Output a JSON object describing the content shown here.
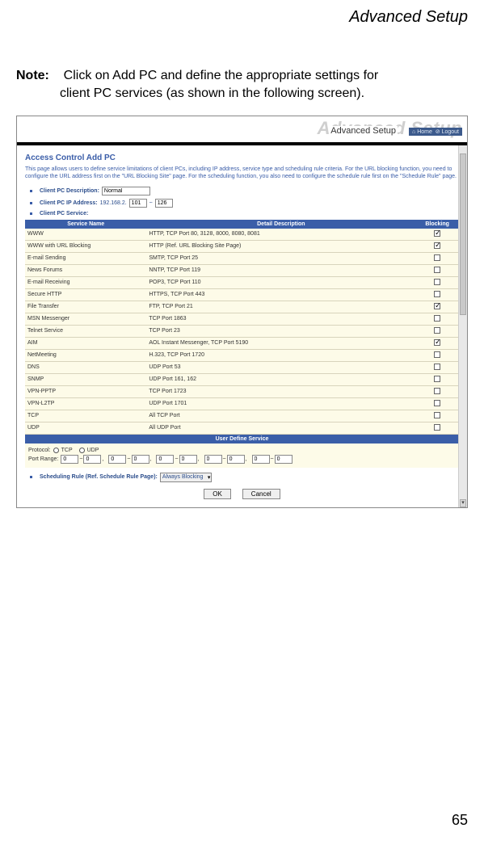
{
  "header": {
    "title": "Advanced Setup"
  },
  "note": {
    "label": "Note:",
    "line1": "Click on Add PC and define the appropriate settings for",
    "line2": "client PC services (as shown in the following screen)."
  },
  "screenshot": {
    "watermark": "Advanced Setup",
    "overlay": "Advanced Setup",
    "nav_home": "Home",
    "nav_logout": "Logout",
    "panel_title": "Access Control Add PC",
    "panel_desc": "This page allows users to define service limitations of client PCs, including IP address, service type and scheduling rule criteria. For the URL blocking function, you need to configure the URL address first on the \"URL Blocking Site\" page. For the scheduling function, you also need to configure the schedule rule first on the \"Schedule Rule\" page.",
    "client_desc_label": "Client PC Description:",
    "client_desc_value": "Normal",
    "client_ip_label": "Client PC IP Address:",
    "ip_prefix": "192.168.2.",
    "ip_from": "101",
    "ip_sep": "~",
    "ip_to": "126",
    "client_service_label": "Client PC Service:",
    "table_headers": {
      "name": "Service Name",
      "desc": "Detail Description",
      "blk": "Blocking"
    },
    "services": [
      {
        "name": "WWW",
        "desc": "HTTP, TCP Port 80, 3128, 8000, 8080, 8081",
        "checked": true
      },
      {
        "name": "WWW with URL Blocking",
        "desc": "HTTP (Ref. URL Blocking Site Page)",
        "checked": true
      },
      {
        "name": "E-mail Sending",
        "desc": "SMTP, TCP Port 25",
        "checked": false
      },
      {
        "name": "News Forums",
        "desc": "NNTP, TCP Port 119",
        "checked": false
      },
      {
        "name": "E-mail Receiving",
        "desc": "POP3, TCP Port 110",
        "checked": false
      },
      {
        "name": "Secure HTTP",
        "desc": "HTTPS, TCP Port 443",
        "checked": false
      },
      {
        "name": "File Transfer",
        "desc": "FTP, TCP Port 21",
        "checked": true
      },
      {
        "name": "MSN Messenger",
        "desc": "TCP Port 1863",
        "checked": false
      },
      {
        "name": "Telnet Service",
        "desc": "TCP Port 23",
        "checked": false
      },
      {
        "name": "AIM",
        "desc": "AOL Instant Messenger, TCP Port 5190",
        "checked": true
      },
      {
        "name": "NetMeeting",
        "desc": "H.323, TCP Port 1720",
        "checked": false
      },
      {
        "name": "DNS",
        "desc": "UDP Port 53",
        "checked": false
      },
      {
        "name": "SNMP",
        "desc": "UDP Port 161, 162",
        "checked": false
      },
      {
        "name": "VPN-PPTP",
        "desc": "TCP Port 1723",
        "checked": false
      },
      {
        "name": "VPN-L2TP",
        "desc": "UDP Port 1701",
        "checked": false
      },
      {
        "name": "TCP",
        "desc": "All TCP Port",
        "checked": false
      },
      {
        "name": "UDP",
        "desc": "All UDP Port",
        "checked": false
      }
    ],
    "uds_header": "User Define Service",
    "protocol_label": "Protocol:",
    "protocol_tcp": "TCP",
    "protocol_udp": "UDP",
    "port_range_label": "Port Range:",
    "port_zero": "0",
    "port_tilde": "~",
    "port_comma": ",",
    "sched_label": "Scheduling Rule (Ref. Schedule Rule Page):",
    "sched_value": "Always Blocking",
    "btn_ok": "OK",
    "btn_cancel": "Cancel"
  },
  "page_number": "65"
}
